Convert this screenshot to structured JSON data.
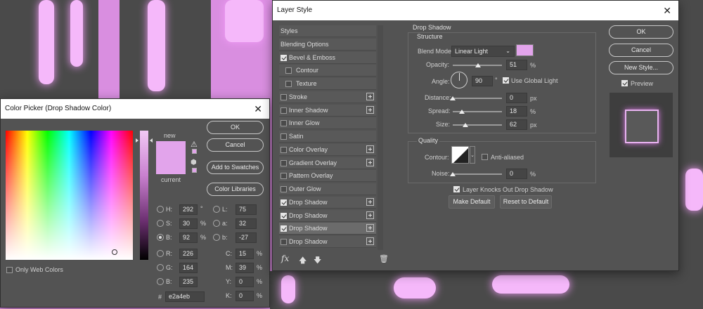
{
  "color_picker": {
    "title": "Color Picker (Drop Shadow Color)",
    "close_glyph": "✕",
    "new_label": "new",
    "current_label": "current",
    "new_color": "#e2a4eb",
    "current_color": "#e2a4eb",
    "buttons": {
      "ok": "OK",
      "cancel": "Cancel",
      "add_swatches": "Add to Swatches",
      "color_libraries": "Color Libraries"
    },
    "only_web_colors": "Only Web Colors",
    "hsb": [
      {
        "label": "H:",
        "value": "292",
        "unit": "°"
      },
      {
        "label": "S:",
        "value": "30",
        "unit": "%"
      },
      {
        "label": "B:",
        "value": "92",
        "unit": "%"
      }
    ],
    "rgb": [
      {
        "label": "R:",
        "value": "226"
      },
      {
        "label": "G:",
        "value": "164"
      },
      {
        "label": "B:",
        "value": "235"
      }
    ],
    "lab": [
      {
        "label": "L:",
        "value": "75"
      },
      {
        "label": "a:",
        "value": "32"
      },
      {
        "label": "b:",
        "value": "-27"
      }
    ],
    "cmyk": [
      {
        "label": "C:",
        "value": "15",
        "unit": "%"
      },
      {
        "label": "M:",
        "value": "39",
        "unit": "%"
      },
      {
        "label": "Y:",
        "value": "0",
        "unit": "%"
      },
      {
        "label": "K:",
        "value": "0",
        "unit": "%"
      }
    ],
    "hex_label": "#",
    "hex_value": "e2a4eb"
  },
  "layer_style": {
    "title": "Layer Style",
    "close_glyph": "✕",
    "styles": [
      {
        "label": "Styles",
        "checkbox": false,
        "checked": false,
        "plus": false,
        "indent": false
      },
      {
        "label": "Blending Options",
        "checkbox": false,
        "checked": false,
        "plus": false,
        "indent": false
      },
      {
        "label": "Bevel & Emboss",
        "checkbox": true,
        "checked": true,
        "plus": false,
        "indent": false
      },
      {
        "label": "Contour",
        "checkbox": true,
        "checked": false,
        "plus": false,
        "indent": true
      },
      {
        "label": "Texture",
        "checkbox": true,
        "checked": false,
        "plus": false,
        "indent": true
      },
      {
        "label": "Stroke",
        "checkbox": true,
        "checked": false,
        "plus": true,
        "indent": false
      },
      {
        "label": "Inner Shadow",
        "checkbox": true,
        "checked": false,
        "plus": true,
        "indent": false
      },
      {
        "label": "Inner Glow",
        "checkbox": true,
        "checked": false,
        "plus": false,
        "indent": false
      },
      {
        "label": "Satin",
        "checkbox": true,
        "checked": false,
        "plus": false,
        "indent": false
      },
      {
        "label": "Color Overlay",
        "checkbox": true,
        "checked": false,
        "plus": true,
        "indent": false
      },
      {
        "label": "Gradient Overlay",
        "checkbox": true,
        "checked": false,
        "plus": true,
        "indent": false
      },
      {
        "label": "Pattern Overlay",
        "checkbox": true,
        "checked": false,
        "plus": false,
        "indent": false
      },
      {
        "label": "Outer Glow",
        "checkbox": true,
        "checked": false,
        "plus": false,
        "indent": false
      },
      {
        "label": "Drop Shadow",
        "checkbox": true,
        "checked": true,
        "plus": true,
        "indent": false
      },
      {
        "label": "Drop Shadow",
        "checkbox": true,
        "checked": true,
        "plus": true,
        "indent": false
      },
      {
        "label": "Drop Shadow",
        "checkbox": true,
        "checked": true,
        "plus": true,
        "indent": false,
        "selected": true
      },
      {
        "label": "Drop Shadow",
        "checkbox": true,
        "checked": false,
        "plus": true,
        "indent": false
      }
    ],
    "footer": {
      "fx": "fx",
      "up_icon": "arrow-up-icon",
      "down_icon": "arrow-down-icon",
      "trash_icon": "trash-icon"
    },
    "drop_shadow": {
      "section_title": "Drop Shadow",
      "structure_title": "Structure",
      "blend_mode_label": "Blend Mode:",
      "blend_mode_value": "Linear Light",
      "shadow_color": "#e2a4eb",
      "opacity_label": "Opacity:",
      "opacity_value": "51",
      "opacity_unit": "%",
      "opacity_level": 0.51,
      "angle_label": "Angle:",
      "angle_value": "90",
      "angle_unit": "°",
      "use_global_light": "Use Global Light",
      "use_global_light_checked": true,
      "distance_label": "Distance:",
      "distance_value": "0",
      "distance_unit": "px",
      "distance_level": 0.0,
      "spread_label": "Spread:",
      "spread_value": "18",
      "spread_unit": "%",
      "spread_level": 0.18,
      "size_label": "Size:",
      "size_value": "62",
      "size_unit": "px",
      "size_level": 0.25,
      "quality_title": "Quality",
      "contour_label": "Contour:",
      "anti_aliased": "Anti-aliased",
      "anti_aliased_checked": false,
      "noise_label": "Noise:",
      "noise_value": "0",
      "noise_unit": "%",
      "noise_level": 0.0,
      "knocks_out": "Layer Knocks Out Drop Shadow",
      "knocks_out_checked": true,
      "make_default": "Make Default",
      "reset_default": "Reset to Default"
    },
    "buttons": {
      "ok": "OK",
      "cancel": "Cancel",
      "new_style": "New Style..."
    },
    "preview_label": "Preview",
    "preview_checked": true
  }
}
